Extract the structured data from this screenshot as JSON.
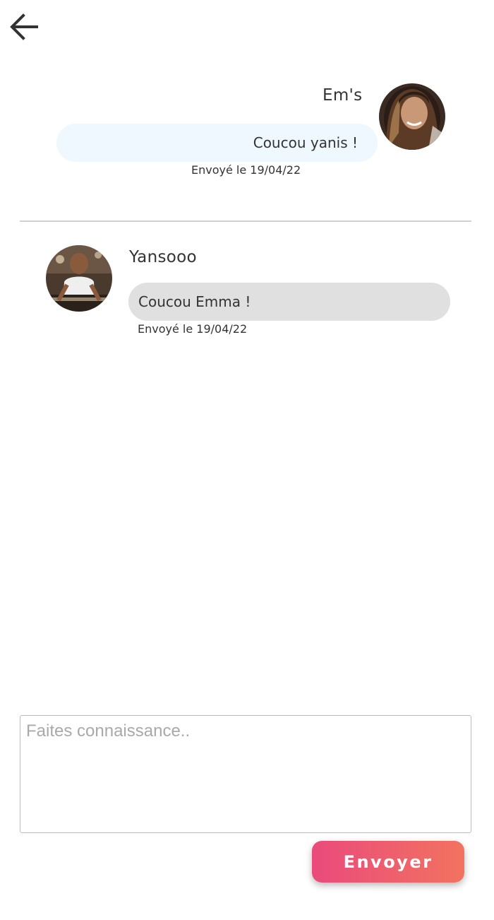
{
  "header": {
    "back_icon": "arrow-left-icon"
  },
  "messages": [
    {
      "sender": "Em's",
      "text": "Coucou yanis !",
      "sent": "Envoyé le 19/04/22",
      "side": "right",
      "bubble_color": "#eef8fe"
    },
    {
      "sender": "Yansooo",
      "text": "Coucou Emma !",
      "sent": "Envoyé le 19/04/22",
      "side": "left",
      "bubble_color": "#e0e0e0"
    }
  ],
  "compose": {
    "placeholder": "Faites connaissance..",
    "value": ""
  },
  "send_button": {
    "label": "Envoyer",
    "gradient_start": "#ea4a7c",
    "gradient_end": "#f2735f"
  }
}
